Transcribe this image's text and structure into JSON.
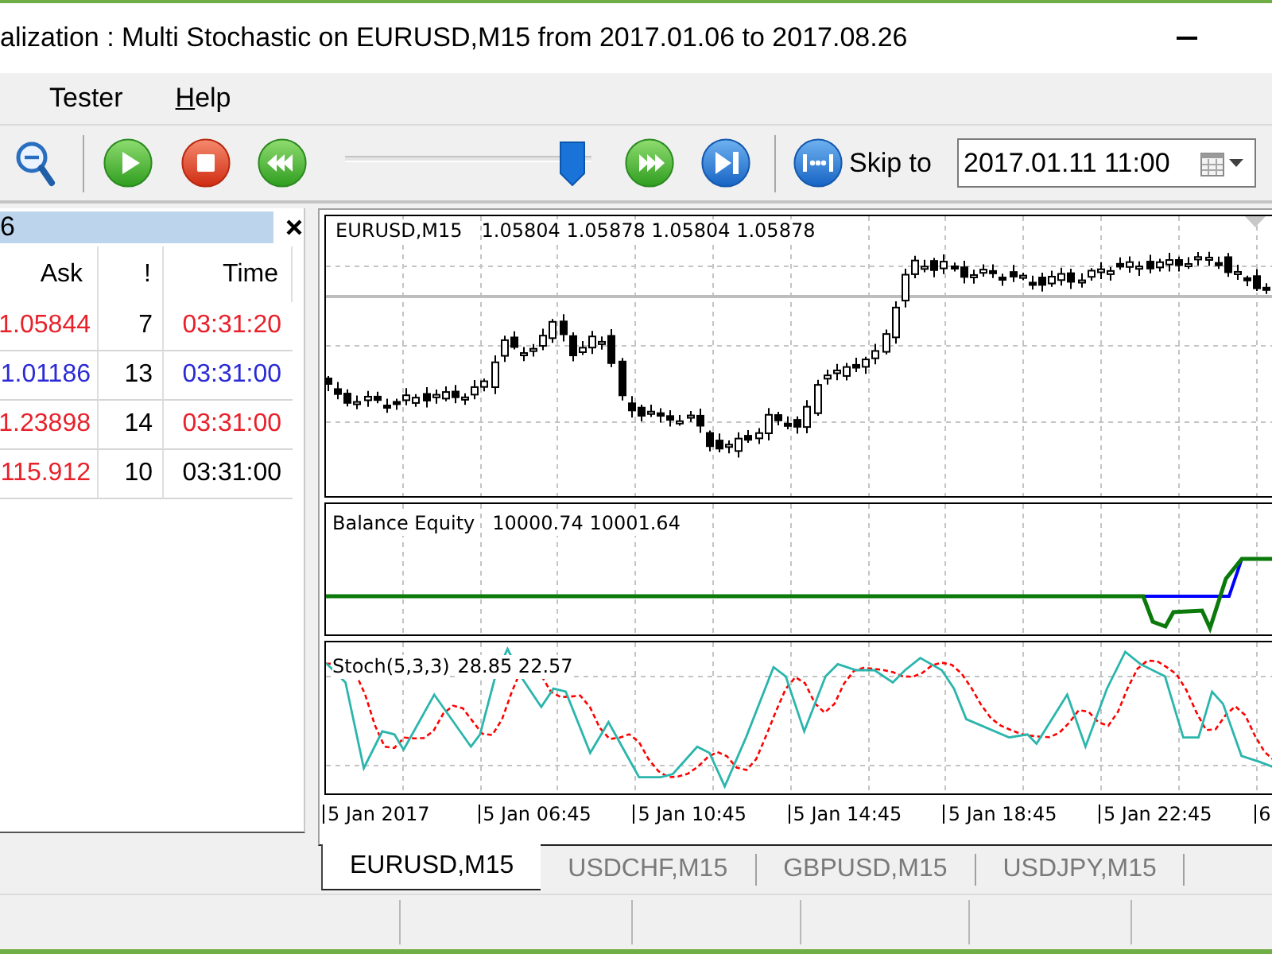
{
  "window": {
    "title": "alization : Multi Stochastic on EURUSD,M15 from 2017.01.06 to 2017.08.26"
  },
  "menu": [
    {
      "label": "Tester",
      "mnemonic": false
    },
    {
      "label": "Help",
      "mnemonic": true
    }
  ],
  "toolbar": {
    "speed_slider": {
      "level": 0.97
    },
    "skip_button": {
      "label": "Skip to"
    },
    "date_field": {
      "value": "2017.01.11 11:00"
    }
  },
  "market_watch": {
    "title": "6",
    "columns": [
      "Ask",
      "!",
      "Time"
    ],
    "rows": [
      {
        "ask": {
          "text": "1.05844",
          "color": "#e8212b"
        },
        "count": "7",
        "time": {
          "text": "03:31:20",
          "color": "#e8212b"
        }
      },
      {
        "ask": {
          "text": "1.01186",
          "color": "#2a2ad6"
        },
        "count": "13",
        "time": {
          "text": "03:31:00",
          "color": "#2a2ad6"
        }
      },
      {
        "ask": {
          "text": "1.23898",
          "color": "#e8212b"
        },
        "count": "14",
        "time": {
          "text": "03:31:00",
          "color": "#e8212b"
        }
      },
      {
        "ask": {
          "text": "115.912",
          "color": "#e8212b"
        },
        "count": "10",
        "time": {
          "text": "03:31:00",
          "color": "#000000"
        }
      }
    ]
  },
  "chart": {
    "panes": [
      {
        "kind": "price",
        "label": "EURUSD,M15",
        "values": "1.05804 1.05878 1.05804 1.05878"
      },
      {
        "kind": "balance",
        "label": "Balance Equity",
        "values": "10000.74 10001.64"
      },
      {
        "kind": "stochastic",
        "label": "Stoch(5,3,3)",
        "values": "28.85 22.57"
      }
    ],
    "time_axis": [
      "5 Jan 2017",
      "5 Jan 06:45",
      "5 Jan 10:45",
      "5 Jan 14:45",
      "5 Jan 18:45",
      "5 Jan 22:45",
      "6"
    ]
  },
  "tabs": [
    {
      "label": "EURUSD,M15",
      "selected": true
    },
    {
      "label": "USDCHF,M15",
      "selected": false
    },
    {
      "label": "GBPUSD,M15",
      "selected": false
    },
    {
      "label": "USDJPY,M15",
      "selected": false
    }
  ]
}
